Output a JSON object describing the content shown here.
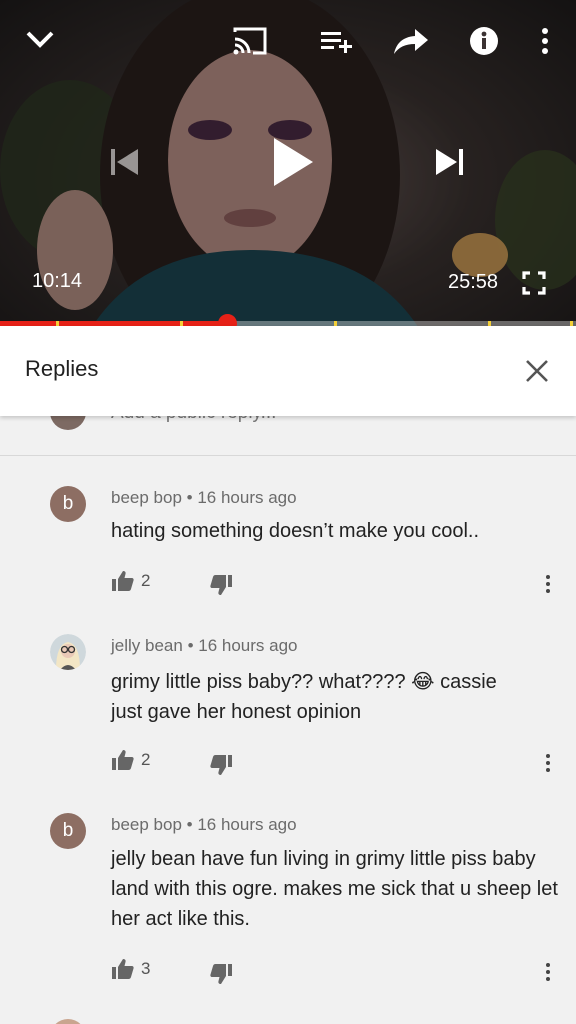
{
  "player": {
    "current_time": "10:14",
    "duration": "25:58",
    "progress_fraction": 0.394
  },
  "replies_panel": {
    "title": "Replies",
    "add_reply_placeholder": "Add a public reply..."
  },
  "comments": [
    {
      "avatar_letter": "b",
      "avatar_color": "#8d6e63",
      "author": "beep bop",
      "time": "16 hours ago",
      "text": "hating something doesn’t make you cool..",
      "likes": "2"
    },
    {
      "avatar_letter": "",
      "avatar_color": "#cfd8dc",
      "author": "jelly bean",
      "time": "16 hours ago",
      "text_before_emoji": "grimy little piss baby?? what????",
      "emoji": "😂",
      "text_after_emoji": "cassie",
      "text_line2": "just gave her honest opinion",
      "likes": "2"
    },
    {
      "avatar_letter": "b",
      "avatar_color": "#8d6e63",
      "author": "beep bop",
      "time": "16 hours ago",
      "text": "jelly bean have fun living in grimy little piss baby land with this ogre. makes me sick that u sheep let her act like this.",
      "likes": "3"
    }
  ],
  "meta_separator": "•",
  "colors": {
    "accent_red": "#e62117",
    "chapter_marker": "#f4d038"
  }
}
